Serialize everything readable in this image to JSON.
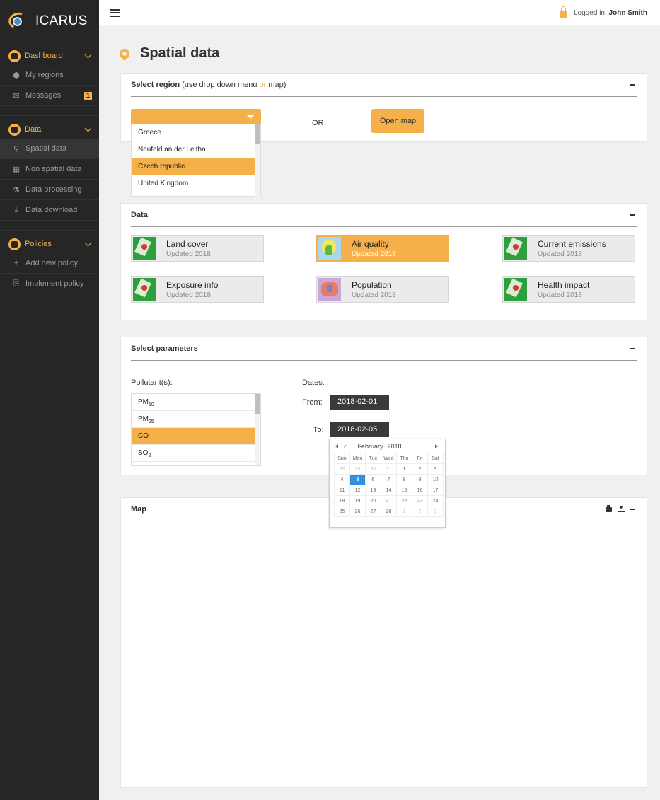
{
  "app": {
    "name": "ICARUS"
  },
  "topbar": {
    "login_prefix": "Logged in:",
    "user": "John Smith"
  },
  "sidebar": {
    "groups": [
      {
        "label": "Dashboard",
        "items": [
          {
            "label": "My regions",
            "icon": "circle-icon"
          },
          {
            "label": "Messages",
            "icon": "envelope-icon",
            "badge": "1"
          }
        ]
      },
      {
        "label": "Data",
        "items": [
          {
            "label": "Spatial data",
            "icon": "map-pin-icon",
            "active": true
          },
          {
            "label": "Non spatial data",
            "icon": "table-icon"
          },
          {
            "label": "Data processing",
            "icon": "processing-icon"
          },
          {
            "label": "Data download",
            "icon": "download-icon"
          }
        ]
      },
      {
        "label": "Policies",
        "items": [
          {
            "label": "Add new policy",
            "icon": "plus-icon"
          },
          {
            "label": "Implement policy",
            "icon": "document-icon"
          }
        ]
      }
    ]
  },
  "page": {
    "title": "Spatial data"
  },
  "region": {
    "title": "Select region",
    "subtitle_a": "(use drop down menu",
    "subtitle_or": "or",
    "subtitle_b": "map)",
    "options": [
      "Greece",
      "Neufeld an der Leitha",
      "Czech republic",
      "United Kingdom"
    ],
    "selected": "Czech republic",
    "or_label": "OR",
    "open_map_label": "Open map"
  },
  "data": {
    "title": "Data",
    "tiles": [
      {
        "name": "Land cover",
        "updated": "Updated 2018"
      },
      {
        "name": "Air quality",
        "updated": "Updated 2018",
        "selected": true
      },
      {
        "name": "Current emissions",
        "updated": "Updated 2018"
      },
      {
        "name": "Exposure info",
        "updated": "Updated 2018"
      },
      {
        "name": "Population",
        "updated": "Updated 2018"
      },
      {
        "name": "Health impact",
        "updated": "Updated 2018"
      }
    ]
  },
  "params": {
    "title": "Select parameters",
    "pollutant_label": "Pollutant(s):",
    "pollutants": [
      {
        "base": "PM",
        "sub": "10"
      },
      {
        "base": "PM",
        "sub": "25"
      },
      {
        "base": "CO",
        "sub": ""
      },
      {
        "base": "SO",
        "sub": "2"
      }
    ],
    "selected_pollutant": "CO",
    "dates_label": "Dates:",
    "from_label": "From:",
    "from_value": "2018-02-01",
    "to_label": "To:",
    "to_value": "2018-02-05"
  },
  "calendar": {
    "month": "February",
    "year": "2018",
    "weekdays": [
      "Sun",
      "Mon",
      "Tue",
      "Wed",
      "Thu",
      "Fri",
      "Sat"
    ],
    "weeks": [
      [
        "28",
        "29",
        "30",
        "31",
        "1",
        "2",
        "3"
      ],
      [
        "4",
        "5",
        "6",
        "7",
        "8",
        "9",
        "10"
      ],
      [
        "11",
        "12",
        "13",
        "14",
        "15",
        "16",
        "17"
      ],
      [
        "18",
        "19",
        "20",
        "21",
        "22",
        "23",
        "24"
      ],
      [
        "25",
        "26",
        "27",
        "28",
        "1",
        "2",
        "3"
      ]
    ],
    "today": "5"
  },
  "map": {
    "title": "Map"
  },
  "colors": {
    "accent": "#f5b04a",
    "sidebar": "#262626",
    "today": "#2f8fe0"
  }
}
